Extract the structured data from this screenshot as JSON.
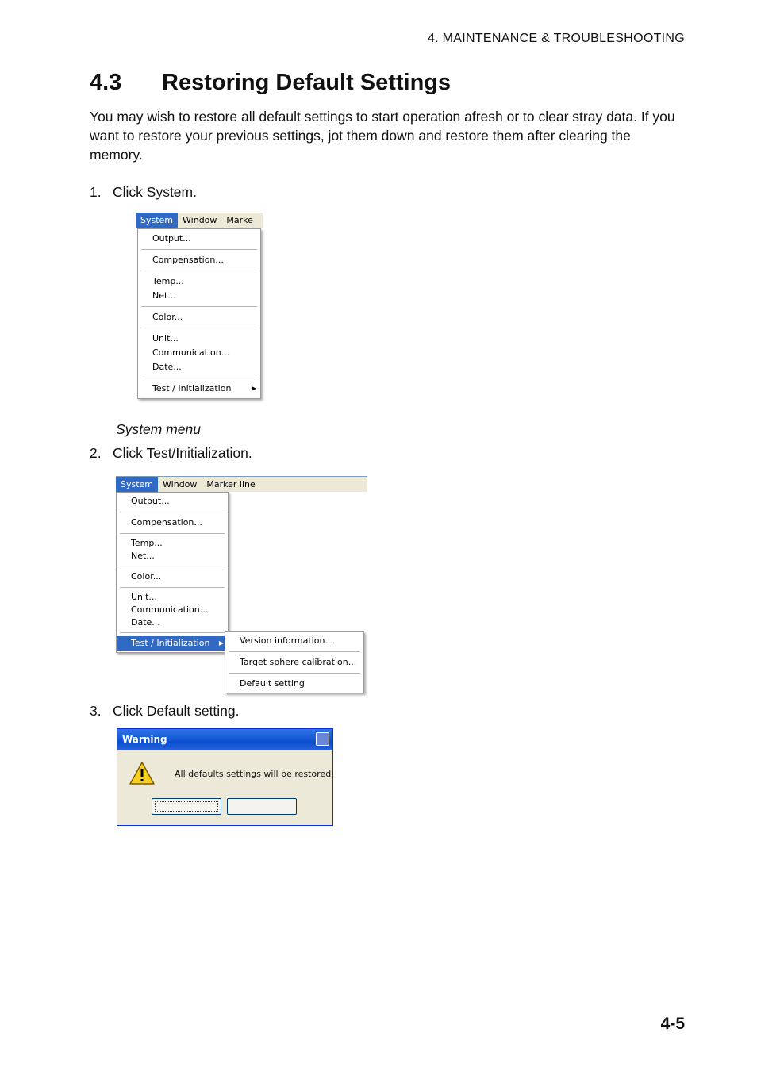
{
  "header": {
    "chapter": "4.  MAINTENANCE  &  TROUBLESHOOTING"
  },
  "section": {
    "number": "4.3",
    "title": "Restoring Default Settings",
    "intro": "You may wish to restore all default settings to start operation afresh or to clear stray data. If you want to restore your previous settings, jot them down and restore them after clearing the memory."
  },
  "steps": [
    {
      "num": "1.",
      "text": "Click System."
    },
    {
      "num": "2.",
      "text": "Click Test/Initialization."
    },
    {
      "num": "3.",
      "text": "Click Default setting."
    }
  ],
  "figure1": {
    "menubar": [
      "System",
      "Window",
      "Marke"
    ],
    "items": [
      "Output...",
      "Compensation...",
      "Temp...",
      "Net...",
      "Color...",
      "Unit...",
      "Communication...",
      "Date...",
      "Test / Initialization"
    ],
    "caption": "System menu"
  },
  "figure2": {
    "menubar": [
      "System",
      "Window",
      "Marker line"
    ],
    "items": [
      "Output...",
      "Compensation...",
      "Temp...",
      "Net...",
      "Color...",
      "Unit...",
      "Communication...",
      "Date...",
      "Test / Initialization"
    ],
    "submenu": [
      "Version information...",
      "Target sphere calibration...",
      "Default setting"
    ]
  },
  "dialog": {
    "title": "Warning",
    "message": "All defaults settings will be restored.",
    "icon": "warning-icon"
  },
  "page_number": "4-5"
}
